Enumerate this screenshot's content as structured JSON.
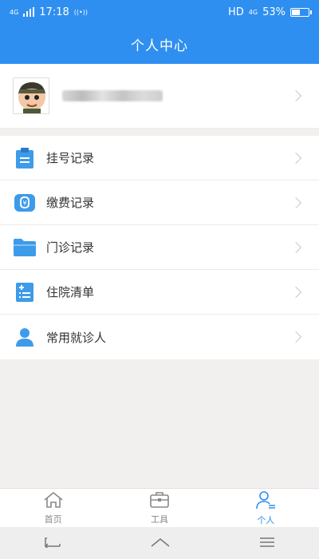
{
  "status_bar": {
    "network_left": "4G",
    "time": "17:18",
    "hd": "HD",
    "network_right": "4G",
    "battery": "53%",
    "battery_level": 0.53
  },
  "header": {
    "title": "个人中心"
  },
  "menu": {
    "items": [
      {
        "label": "挂号记录",
        "icon": "clipboard-icon"
      },
      {
        "label": "缴费记录",
        "icon": "wallet-icon"
      },
      {
        "label": "门诊记录",
        "icon": "folder-icon"
      },
      {
        "label": "住院清单",
        "icon": "hospital-list-icon"
      },
      {
        "label": "常用就诊人",
        "icon": "person-icon"
      }
    ]
  },
  "tabbar": {
    "tabs": [
      {
        "label": "首页",
        "icon": "home-icon"
      },
      {
        "label": "工具",
        "icon": "toolbox-icon"
      },
      {
        "label": "个人",
        "icon": "user-icon",
        "active": true
      }
    ]
  },
  "colors": {
    "primary": "#2f8ff0",
    "icon_blue": "#3d9be9"
  }
}
